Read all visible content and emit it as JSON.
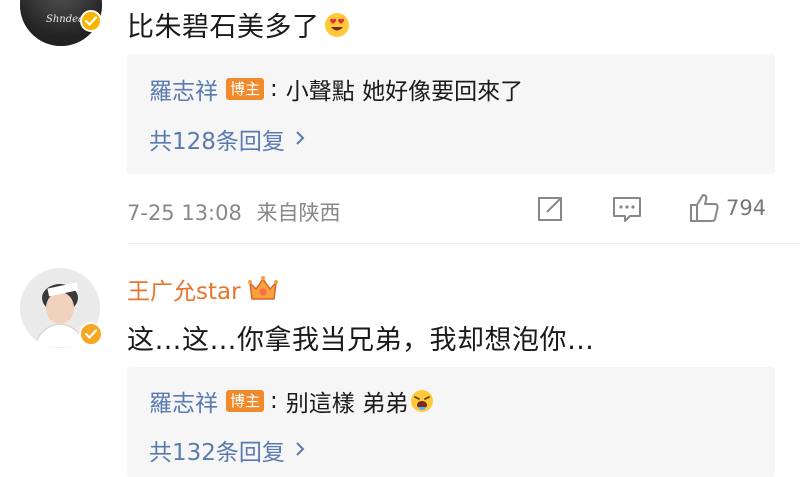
{
  "comment1": {
    "text": "比朱碧石美多了",
    "avatar_text": "Shndear",
    "reply": {
      "author": "羅志祥",
      "badge": "博主",
      "content": "小聲點 她好像要回來了"
    },
    "reply_count": "共128条回复",
    "timestamp": "7-25 13:08",
    "location": "来自陕西",
    "likes": "794"
  },
  "comment2": {
    "username": "王广允star",
    "text": "这…这…你拿我当兄弟，我却想泡你…",
    "reply": {
      "author": "羅志祥",
      "badge": "博主",
      "content": "别這樣 弟弟"
    },
    "reply_count": "共132条回复"
  },
  "colors": {
    "username": "#e8752e",
    "link": "#5a7ab0",
    "badge": "#f08a2c",
    "verified": "#f7b500"
  }
}
